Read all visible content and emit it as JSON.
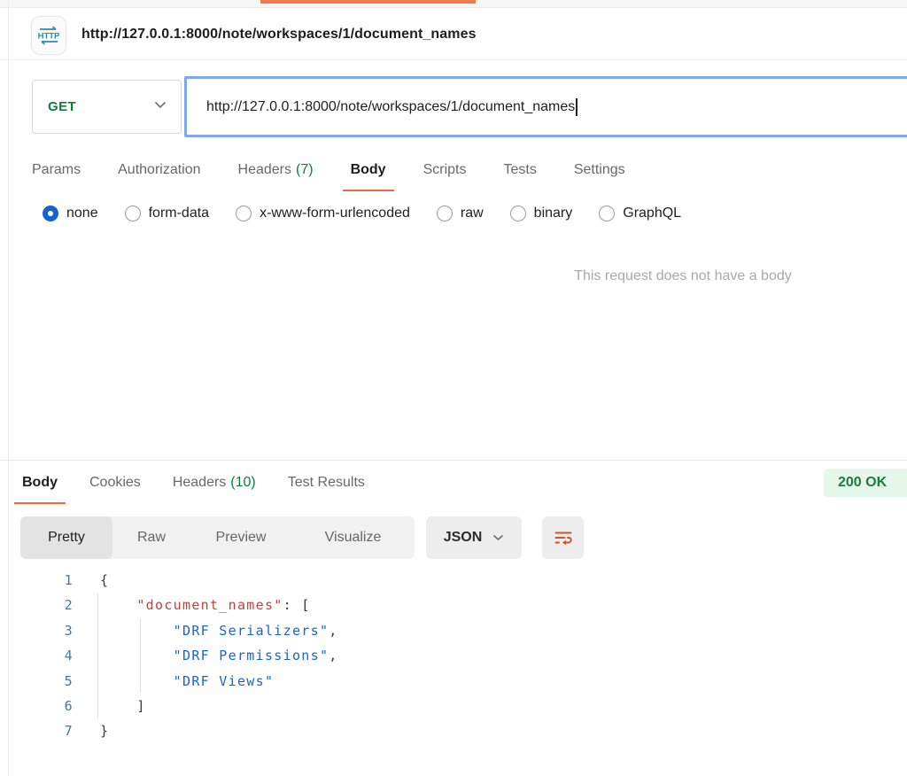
{
  "colors": {
    "accent_orange": "#ef6b3d",
    "top_indicator_orange": "#f3794b",
    "method_green": "#0e7e3c",
    "count_green": "#0f7e3e",
    "focus_blue": "#7fa8f0",
    "radio_blue": "#1663d0",
    "status_badge_bg": "#e4f7ea",
    "status_badge_text": "#1c7c3c",
    "code_key": "#b8453c",
    "code_string": "#1966c4",
    "code_line_number": "#3e79a2"
  },
  "header": {
    "title": "http://127.0.0.1:8000/note/workspaces/1/document_names"
  },
  "request_bar": {
    "method": "GET",
    "url": "http://127.0.0.1:8000/note/workspaces/1/document_names"
  },
  "request_tabs": [
    {
      "label": "Params"
    },
    {
      "label": "Authorization"
    },
    {
      "label": "Headers",
      "count": "(7)"
    },
    {
      "label": "Body",
      "active": true
    },
    {
      "label": "Scripts"
    },
    {
      "label": "Tests"
    },
    {
      "label": "Settings"
    }
  ],
  "body_type_options": [
    {
      "label": "none",
      "selected": true
    },
    {
      "label": "form-data"
    },
    {
      "label": "x-www-form-urlencoded"
    },
    {
      "label": "raw"
    },
    {
      "label": "binary"
    },
    {
      "label": "GraphQL"
    }
  ],
  "empty_body_message": "This request does not have a body",
  "response": {
    "tabs": [
      {
        "label": "Body",
        "active": true
      },
      {
        "label": "Cookies"
      },
      {
        "label": "Headers",
        "count": "(10)"
      },
      {
        "label": "Test Results"
      }
    ],
    "status": "200 OK",
    "view_tabs": [
      {
        "label": "Pretty",
        "active": true
      },
      {
        "label": "Raw"
      },
      {
        "label": "Preview"
      },
      {
        "label": "Visualize"
      }
    ],
    "format": "JSON",
    "body_lines": [
      {
        "num": "1",
        "segments": [
          {
            "text": "{"
          }
        ]
      },
      {
        "num": "2",
        "segments": [
          {
            "text": "    "
          },
          {
            "text": "\"document_names\""
          },
          {
            "text": ": ["
          }
        ]
      },
      {
        "num": "3",
        "segments": [
          {
            "text": "        "
          },
          {
            "text": "\"DRF Serializers\""
          },
          {
            "text": ","
          }
        ]
      },
      {
        "num": "4",
        "segments": [
          {
            "text": "        "
          },
          {
            "text": "\"DRF Permissions\""
          },
          {
            "text": ","
          }
        ]
      },
      {
        "num": "5",
        "segments": [
          {
            "text": "        "
          },
          {
            "text": "\"DRF Views\""
          },
          {
            "text": ""
          }
        ]
      },
      {
        "num": "6",
        "segments": [
          {
            "text": "    ]"
          }
        ]
      },
      {
        "num": "7",
        "segments": [
          {
            "text": "}"
          }
        ]
      }
    ]
  }
}
